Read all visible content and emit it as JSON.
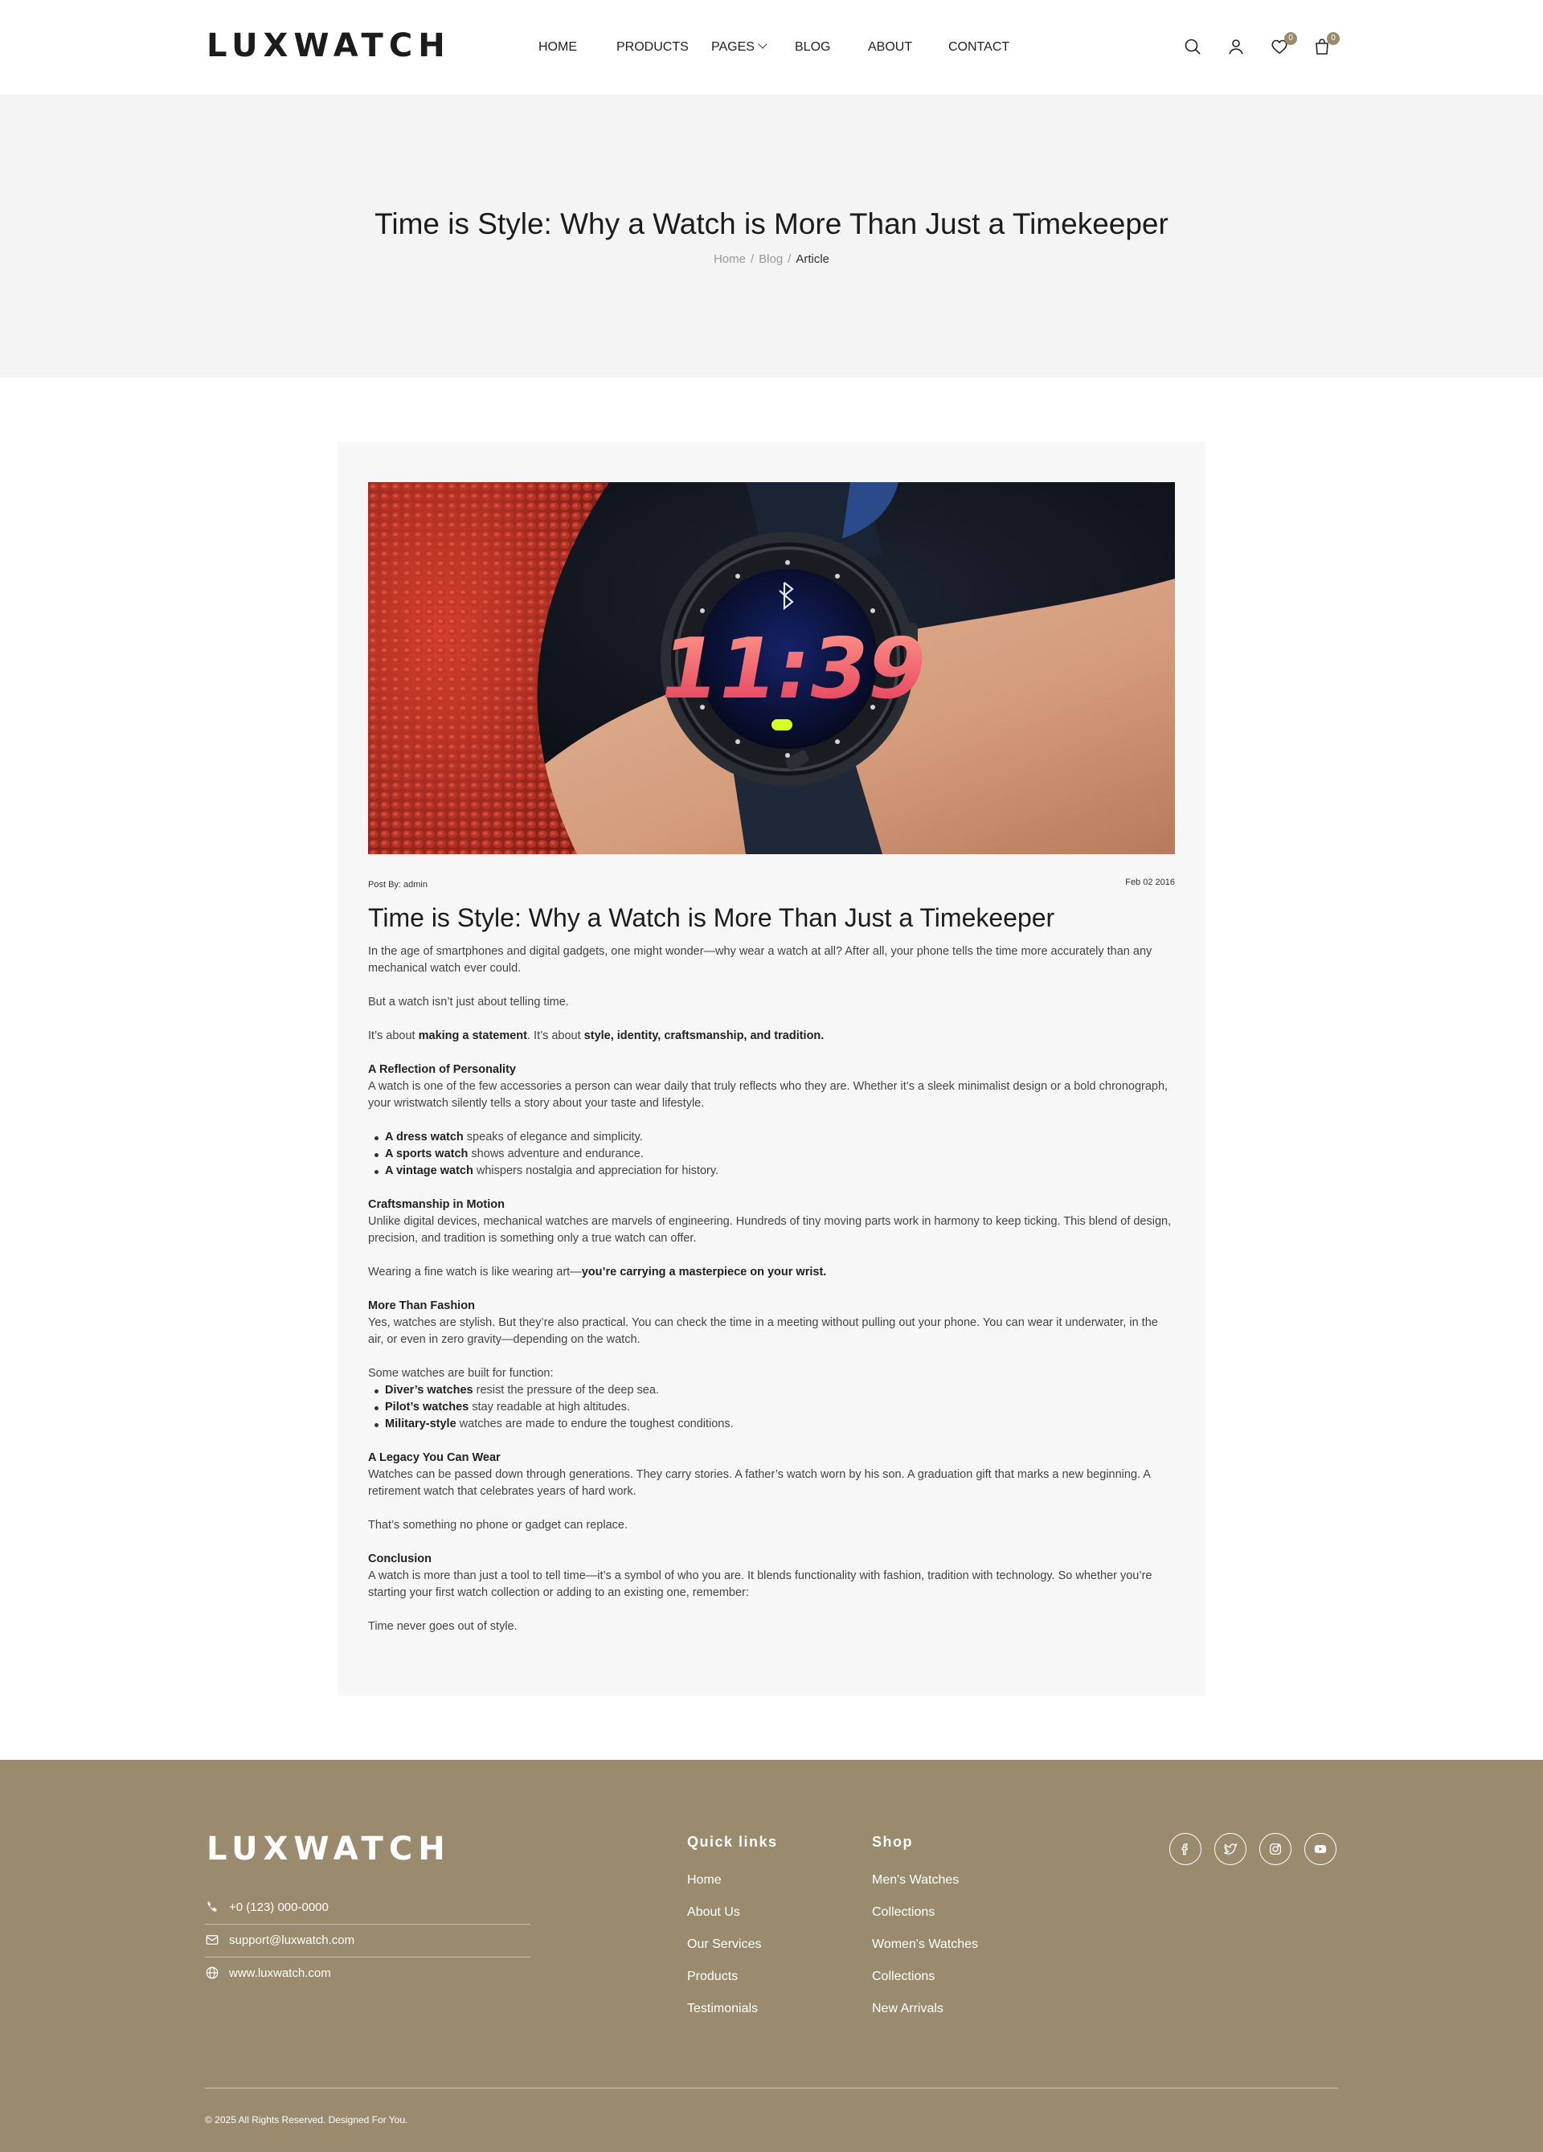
{
  "header": {
    "logo": "LUXWATCH",
    "nav": [
      {
        "label": "HOME"
      },
      {
        "label": "PRODUCTS"
      },
      {
        "label": "PAGES"
      },
      {
        "label": "BLOG"
      },
      {
        "label": "ABOUT"
      },
      {
        "label": "CONTACT"
      }
    ],
    "icons": {
      "search": "search-icon",
      "account": "user-icon",
      "wishlist": "heart-icon",
      "cart": "bag-icon"
    },
    "wishlist_count": "0",
    "cart_count": "0"
  },
  "hero": {
    "title": "Time is Style: Why a Watch is More Than Just a Timekeeper",
    "breadcrumb": [
      {
        "label": "Home"
      },
      {
        "label": "Blog"
      },
      {
        "label": "Article"
      }
    ],
    "separator": "/"
  },
  "article": {
    "image_alt": "Smartwatch on wrist showing 11:39",
    "watch_time": "11:39",
    "post_by": "Post By: admin",
    "date": "Feb 02 2016",
    "title": "Time is Style: Why a Watch is More Than Just a Timekeeper",
    "intro": "In the age of smartphones and digital gadgets, one might wonder—why wear a watch at all? After all, your phone tells the time more accurately than any mechanical watch ever could.",
    "p2": "But a watch isn’t just about telling time.",
    "p3": {
      "a": "It’s about ",
      "b1": "making a statement",
      "c": ". It’s about ",
      "b2": "style, identity, craftsmanship, and tradition."
    },
    "s1": {
      "heading": "A Reflection of Personality",
      "text": "A watch is one of the few accessories a person can wear daily that truly reflects who they are. Whether it’s a sleek minimalist design or a bold chronograph, your wristwatch silently tells a story about your taste and lifestyle.",
      "items": [
        {
          "bold": "A dress watch",
          "rest": " speaks of elegance and simplicity."
        },
        {
          "bold": "A sports watch",
          "rest": " shows adventure and endurance."
        },
        {
          "bold": "A vintage watch",
          "rest": " whispers nostalgia and appreciation for history."
        }
      ]
    },
    "s2": {
      "heading": "Craftsmanship in Motion",
      "text": "Unlike digital devices, mechanical watches are marvels of engineering. Hundreds of tiny moving parts work in harmony to keep ticking. This blend of design, precision, and tradition is something only a true watch can offer.",
      "p_a": "Wearing a fine watch is like wearing art—",
      "p_b": "you’re carrying a masterpiece on your wrist."
    },
    "s3": {
      "heading": "More Than Fashion",
      "text": "Yes, watches are stylish. But they’re also practical. You can check the time in a meeting without pulling out your phone. You can wear it underwater, in the air, or even in zero gravity—depending on the watch.",
      "lead": "Some watches are built for function:",
      "items": [
        {
          "bold": "Diver’s watches",
          "rest": " resist the pressure of the deep sea."
        },
        {
          "bold": "Pilot’s watches",
          "rest": " stay readable at high altitudes."
        },
        {
          "bold": "Military-style",
          "rest": " watches are made to endure the toughest conditions."
        }
      ]
    },
    "s4": {
      "heading": "A Legacy You Can Wear",
      "text": "Watches can be passed down through generations. They carry stories. A father’s watch worn by his son. A graduation gift that marks a new beginning. A retirement watch that celebrates years of hard work.",
      "p": "That’s something no phone or gadget can replace."
    },
    "s5": {
      "heading": "Conclusion",
      "text": "A watch is more than just a tool to tell time—it’s a symbol of who you are. It blends functionality with fashion, tradition with technology. So whether you’re starting your first watch collection or adding to an existing one, remember:",
      "p": "Time never goes out of style."
    }
  },
  "footer": {
    "logo": "LUXWATCH",
    "contact": {
      "phone": "+0 (123) 000-0000",
      "email": "support@luxwatch.com",
      "web": "www.luxwatch.com"
    },
    "quick_links": {
      "title": "Quick links",
      "links": [
        "Home",
        "About Us",
        "Our Services",
        "Products",
        "Testimonials"
      ]
    },
    "shop": {
      "title": "Shop",
      "links": [
        "Men's Watches",
        "Collections",
        "Women's Watches",
        "Collections",
        "New Arrivals"
      ]
    },
    "social": [
      "facebook-icon",
      "twitter-icon",
      "instagram-icon",
      "youtube-icon"
    ],
    "copyright": "© 2025 All Rights Reserved. Designed For You."
  },
  "colors": {
    "brand": "#9b8b6e",
    "hero_bg": "#f4f4f4",
    "card_bg": "#f7f7f7",
    "text": "#222222"
  }
}
